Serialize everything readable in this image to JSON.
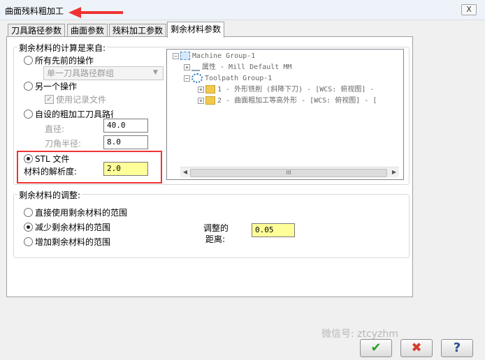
{
  "window": {
    "title": "曲面残料粗加工",
    "close_glyph": "X"
  },
  "tabs": [
    {
      "label": "刀具路径参数"
    },
    {
      "label": "曲面参数"
    },
    {
      "label": "残料加工参数"
    },
    {
      "label": "剩余材料参数"
    }
  ],
  "source_group": {
    "legend": "剩余材料的计算是来自:",
    "all_previous_label": "所有先前的操作",
    "single_group_combo": "单一刀具路径群组",
    "another_op_label": "另一个操作",
    "use_log_label": "使用记录文件",
    "custom_rough_label": "自设的粗加工刀具路径",
    "diameter_label": "直径:",
    "diameter_value": "40.0",
    "corner_radius_label": "刀角半径:",
    "corner_radius_value": "8.0",
    "stl_label": "STL 文件",
    "resolution_label": "材料的解析度:",
    "resolution_value": "2.0"
  },
  "tree": {
    "items": [
      {
        "text": "Machine Group-1"
      },
      {
        "text": "属性 - Mill Default MM"
      },
      {
        "text": "Toolpath Group-1"
      },
      {
        "text": "1 - 外形铣削 (斜降下刀) - [WCS: 俯视图] -"
      },
      {
        "text": "2 - 曲面粗加工等高外形 - [WCS: 俯视图] - ["
      }
    ],
    "scroll_grip": "III"
  },
  "adjust_group": {
    "legend": "剩余材料的调整:",
    "direct_label": "直接使用剩余材料的范围",
    "reduce_label": "减少剩余材料的范围",
    "increase_label": "增加剩余材料的范围",
    "distance_label_line1": "调整的",
    "distance_label_line2": "距离:",
    "distance_value": "0.05"
  },
  "buttons": {
    "ok": "✔",
    "cancel": "✖",
    "help": "?"
  },
  "watermark": "微信号: ztcyzhm",
  "colors": {
    "highlight": "#ffff99",
    "annotation_red": "#e33333",
    "ok_green": "#2e9e2e",
    "cancel_red": "#d43a2a",
    "help_blue": "#2a4c8c"
  }
}
